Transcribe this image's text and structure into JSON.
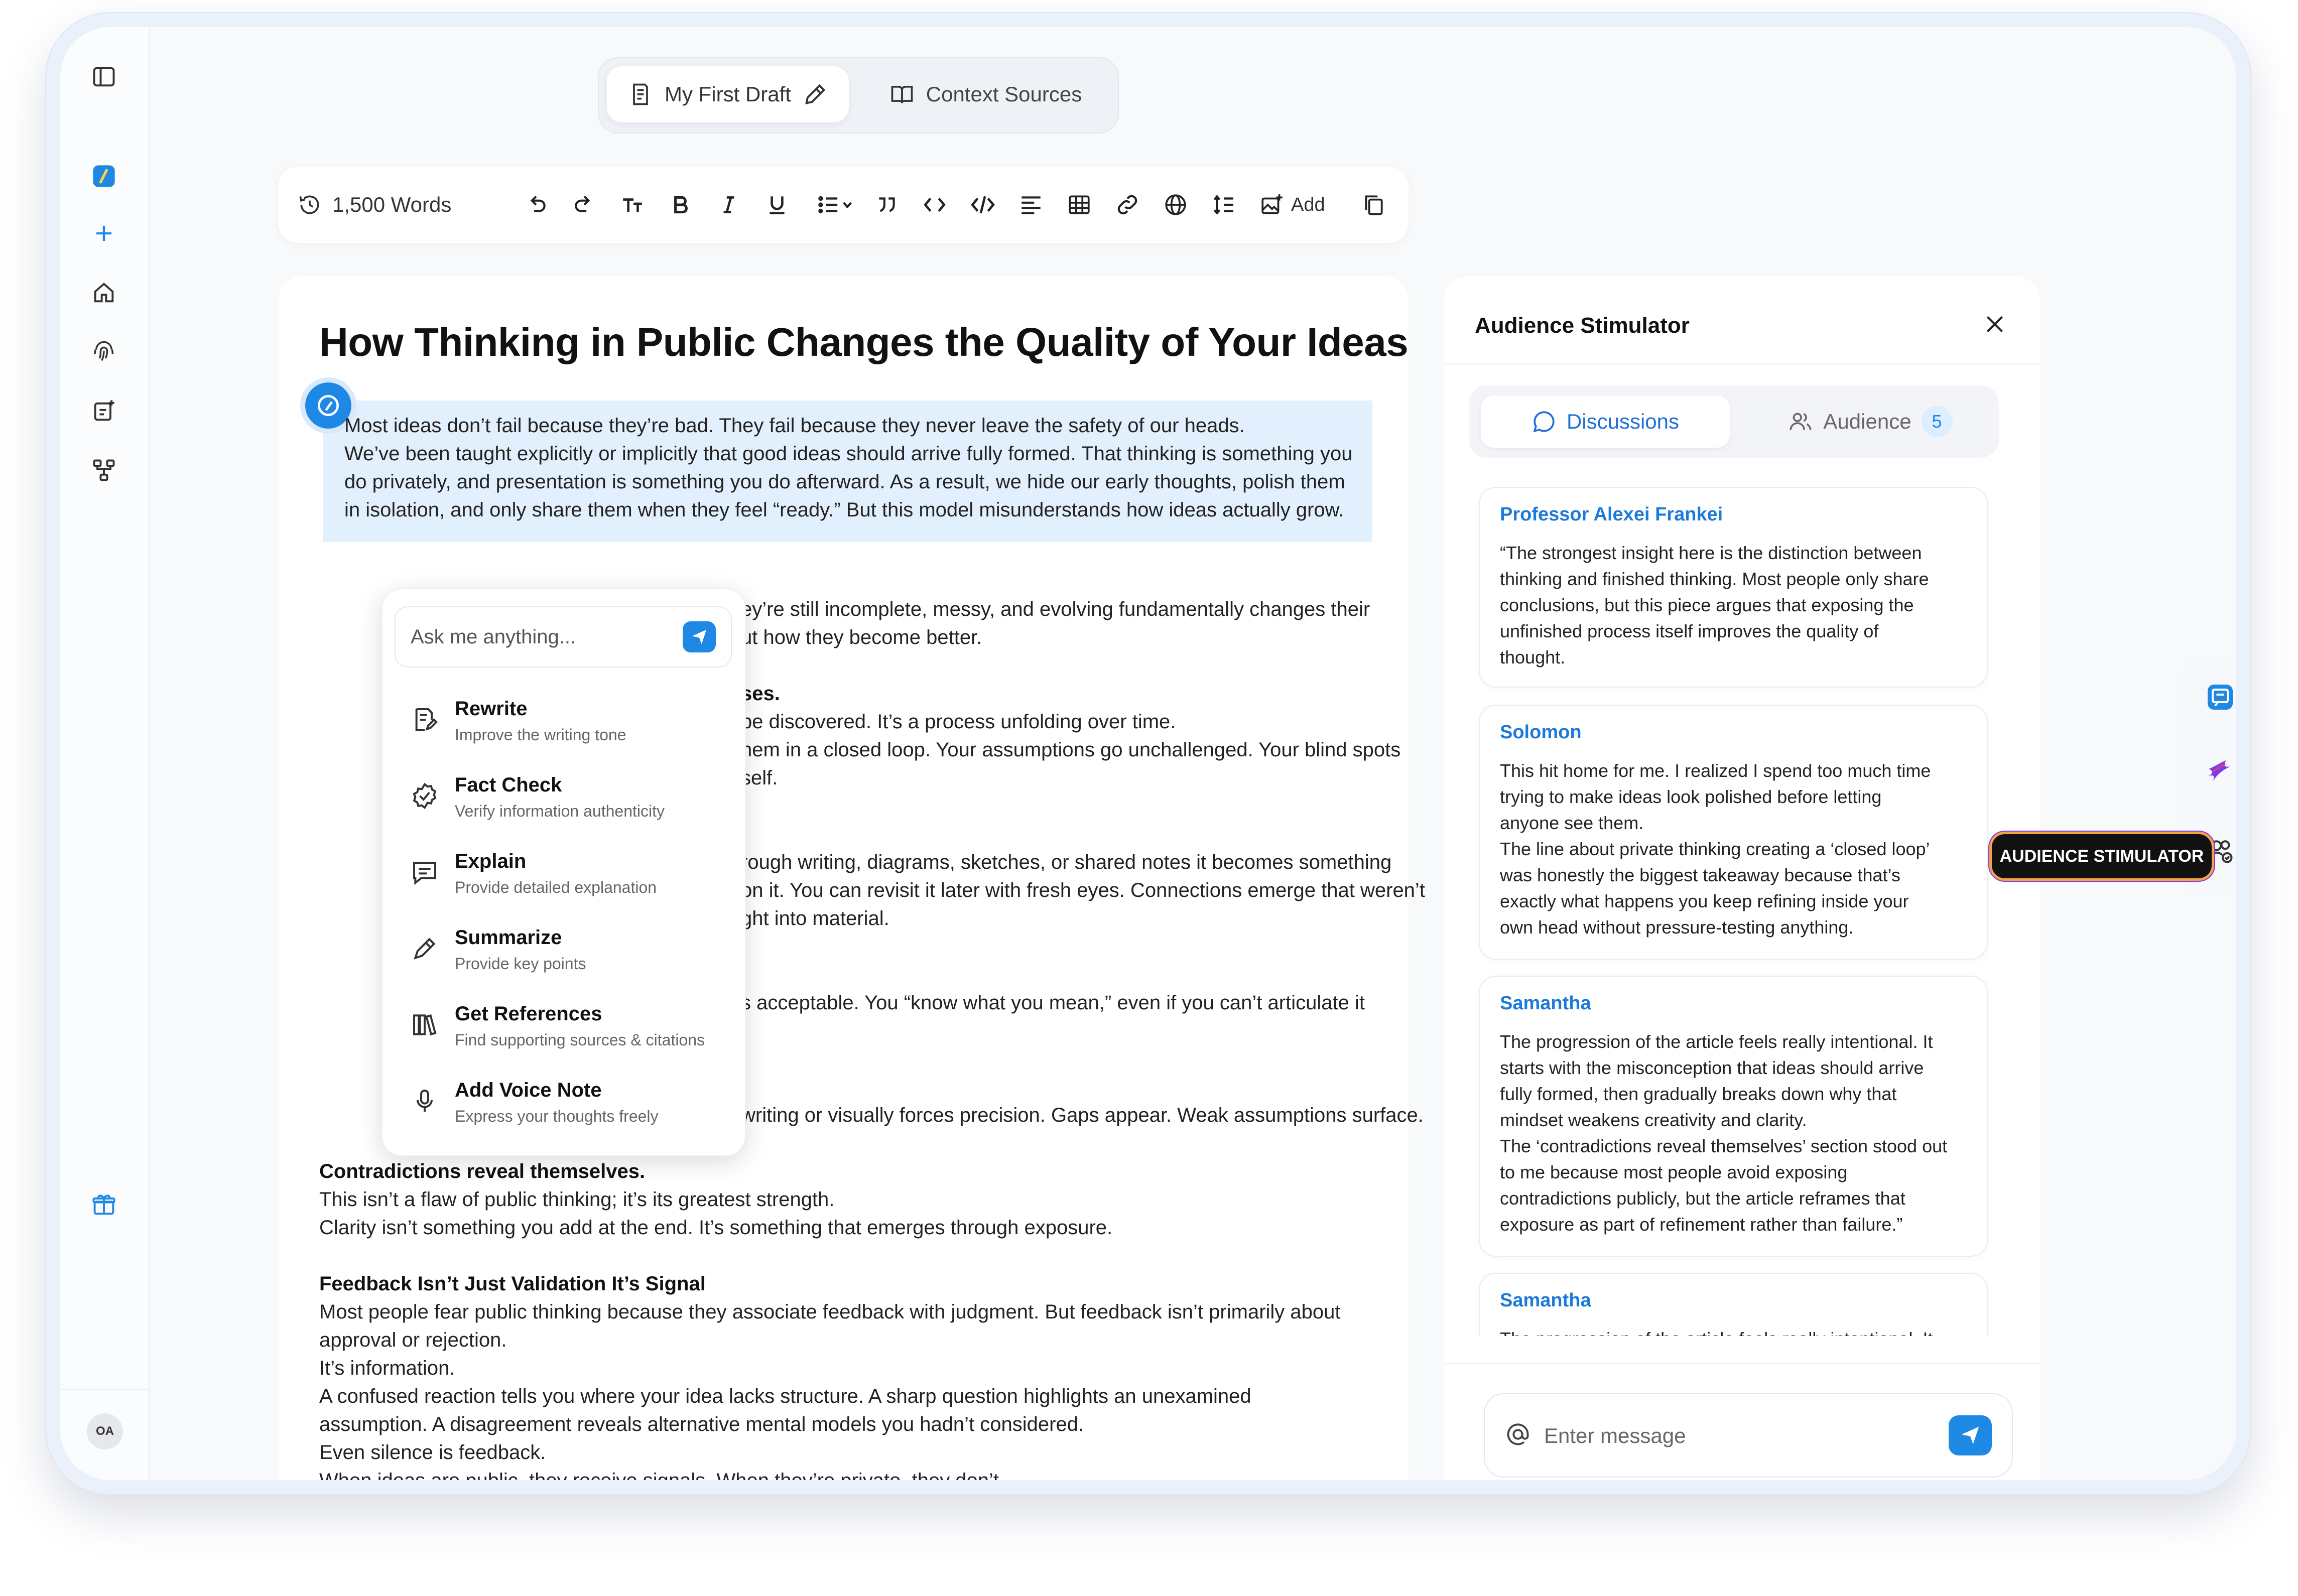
{
  "tabs": {
    "draft": "My First Draft",
    "context": "Context Sources"
  },
  "toolbar": {
    "words": "1,500 Words",
    "add": "Add"
  },
  "editor": {
    "title": "How Thinking in Public Changes the Quality of Your Ideas",
    "lines": [
      "Most ideas don’t fail because they’re bad. They fail because they never leave the safety of our heads.",
      "We’ve been taught explicitly or implicitly that good ideas should arrive fully formed. That thinking is something you",
      "do privately, and presentation is something you do afterward. As a result, we hide our early thoughts, polish them",
      "in isolation, and only share them when they feel “ready.” But this model misunderstands how ideas actually grow.",
      "ey’re still incomplete, messy, and evolving fundamentally changes their",
      "ut how they become better.",
      "ses.",
      "be discovered. It’s a process unfolding over time.",
      "hem in a closed loop. Your assumptions go unchallenged. Your blind spots",
      "self.",
      "rough writing, diagrams, sketches, or shared notes it becomes something",
      "on it. You can revisit it later with fresh eyes. Connections emerge that weren’t",
      "ght into material.",
      "s acceptable. You “know what you mean,” even if you can’t articulate it",
      "writing or visually forces precision. Gaps appear. Weak assumptions surface.",
      "Contradictions reveal themselves.",
      "This isn’t a flaw of public thinking; it’s its greatest strength.",
      "Clarity isn’t something you add at the end. It’s something that emerges through exposure.",
      "Feedback Isn’t Just Validation  It’s Signal",
      "Most people fear public thinking because they associate feedback with judgment. But feedback isn’t primarily about",
      "approval or rejection.",
      "It’s information.",
      "A confused reaction tells you where your idea lacks structure. A sharp question highlights an unexamined",
      "assumption. A disagreement reveals alternative mental models you hadn’t considered.",
      "Even silence is feedback.",
      "When ideas are public, they receive signals. When they’re private, they don’t."
    ]
  },
  "ai_menu": {
    "placeholder": "Ask me anything...",
    "actions": [
      {
        "title": "Rewrite",
        "sub": "Improve the writing tone"
      },
      {
        "title": "Fact Check",
        "sub": "Verify information authenticity"
      },
      {
        "title": "Explain",
        "sub": "Provide detailed explanation"
      },
      {
        "title": "Summarize",
        "sub": "Provide key points"
      },
      {
        "title": "Get References",
        "sub": "Find supporting sources & citations"
      },
      {
        "title": "Add Voice Note",
        "sub": "Express your thoughts freely"
      }
    ]
  },
  "panel": {
    "title": "Audience Stimulator",
    "tab_discussions": "Discussions",
    "tab_audience": "Audience",
    "audience_count": "5",
    "comments": [
      {
        "name": "Professor Alexei Frankei",
        "text": "“The strongest insight here is the distinction between\nthinking and finished thinking. Most people only share\nconclusions, but this piece argues that exposing the\nunfinished process itself improves the quality of\nthought."
      },
      {
        "name": "Solomon",
        "text": "This hit home for me. I realized I spend too much time\ntrying to make ideas look polished before letting\nanyone see them.\nThe line about private thinking creating a ‘closed loop’\nwas honestly the biggest takeaway because that’s\nexactly what happens  you keep refining inside your\nown head without pressure-testing anything."
      },
      {
        "name": "Samantha",
        "text": "The progression of the article feels really intentional. It\nstarts with the misconception that ideas should arrive\nfully formed, then gradually breaks down why that\nmindset weakens creativity and clarity.\nThe ‘contradictions reveal themselves’ section stood out\nto me because most people avoid exposing\ncontradictions publicly, but the article reframes that\nexposure as part of refinement rather than failure.”"
      },
      {
        "name": "Samantha",
        "text": "The progression of the article feels really intentional. It"
      }
    ],
    "message_placeholder": "Enter message"
  },
  "tooltip": "AUDIENCE STIMULATOR",
  "user": {
    "initials": "OA"
  },
  "colors": {
    "accent": "#1e88e5",
    "highlight": "#e2effc",
    "name_blue": "#1e7ad9"
  }
}
